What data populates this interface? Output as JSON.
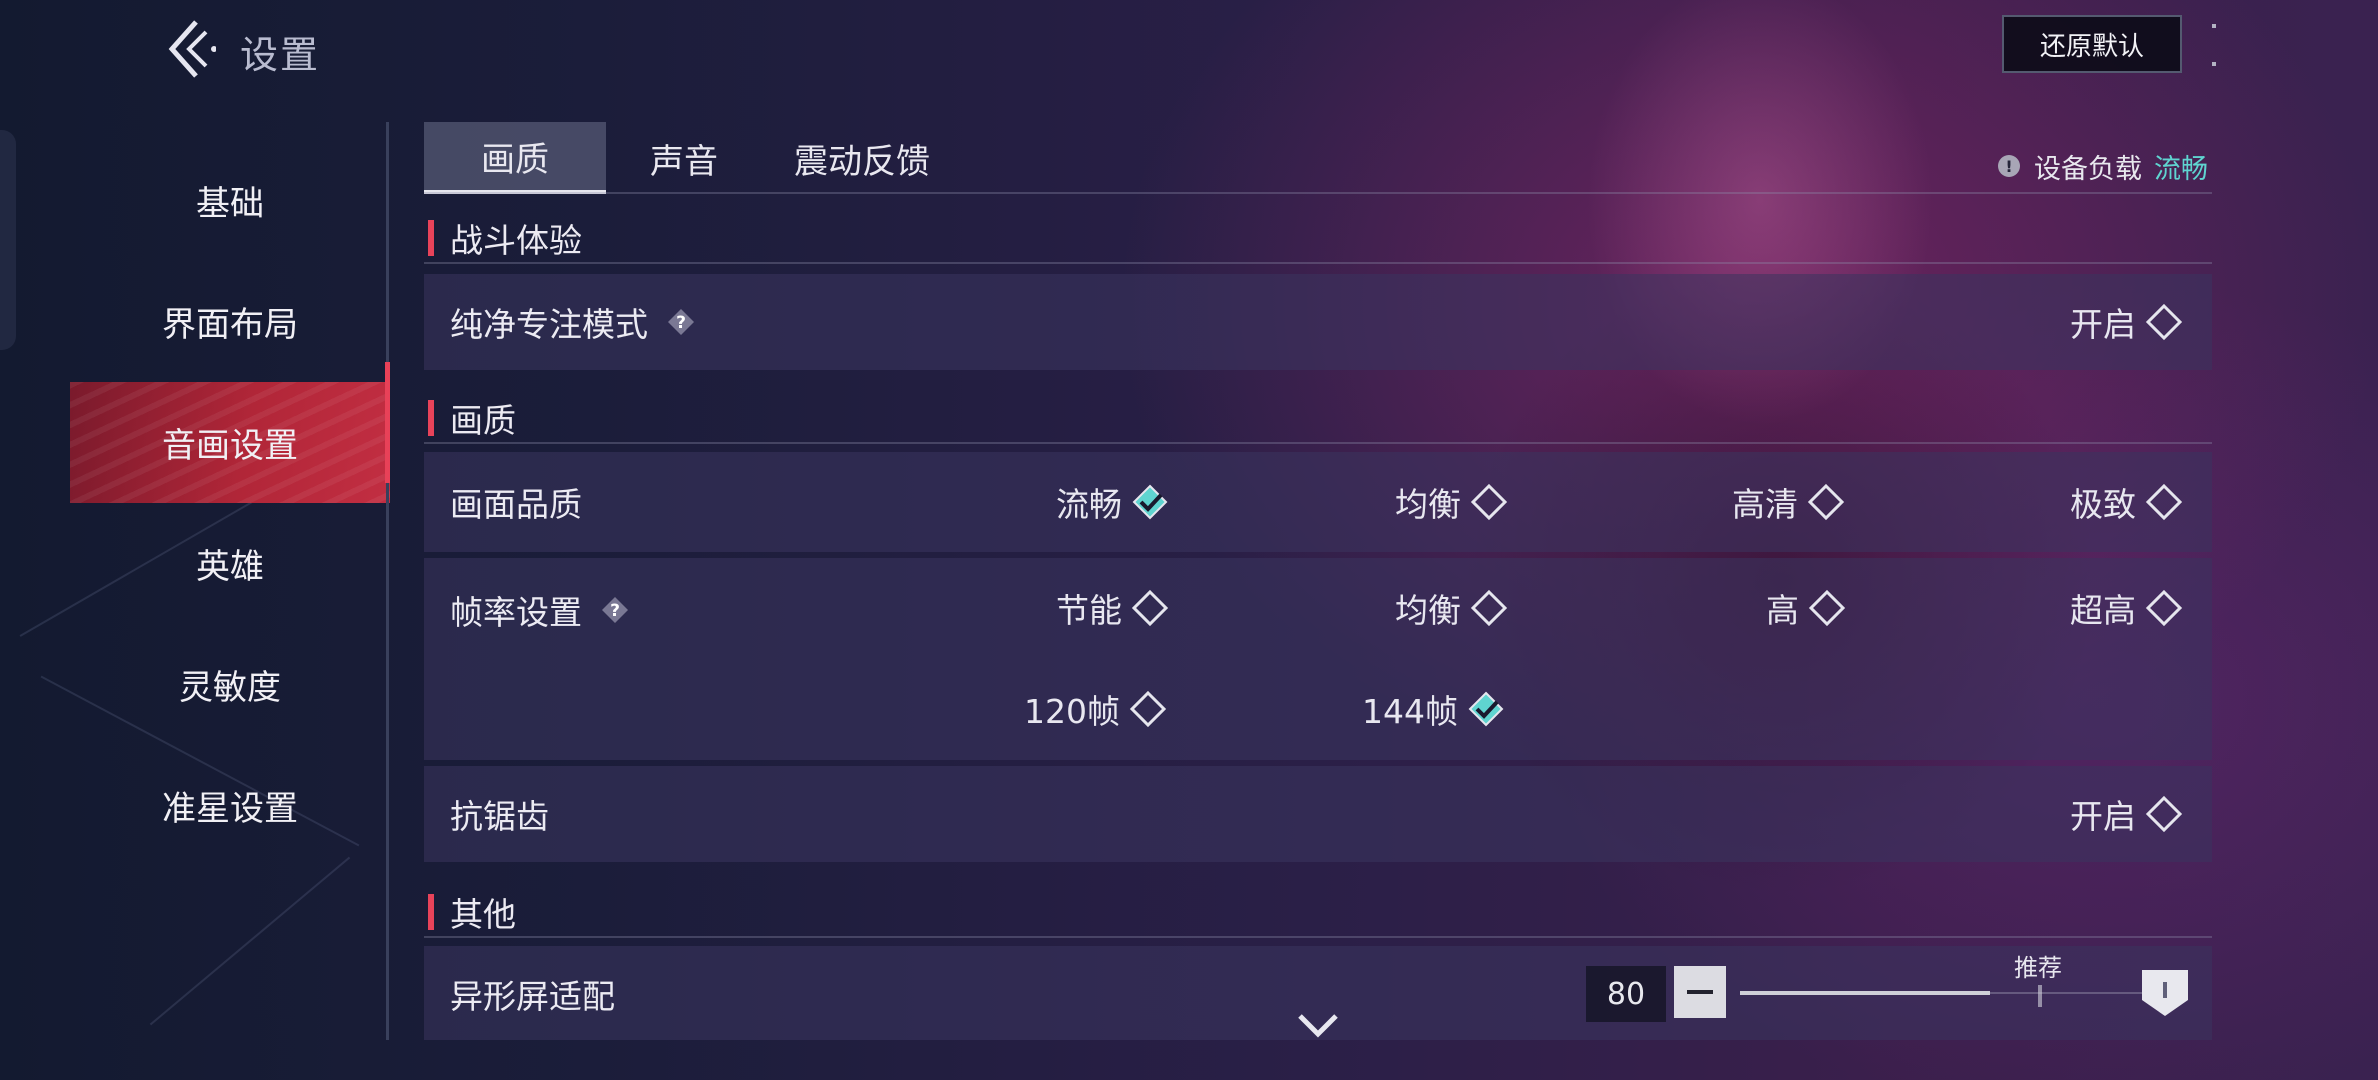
{
  "header": {
    "title": "设置",
    "back_icon": "chevron-left-icon",
    "restore_button": "还原默认"
  },
  "nav": {
    "items": [
      {
        "label": "基础",
        "active": false
      },
      {
        "label": "界面布局",
        "active": false
      },
      {
        "label": "音画设置",
        "active": true
      },
      {
        "label": "英雄",
        "active": false
      },
      {
        "label": "灵敏度",
        "active": false
      },
      {
        "label": "准星设置",
        "active": false
      }
    ]
  },
  "tabs": [
    {
      "label": "画质",
      "active": true
    },
    {
      "label": "声音",
      "active": false
    },
    {
      "label": "震动反馈",
      "active": false
    }
  ],
  "device_load": {
    "label": "设备负载",
    "value": "流畅",
    "value_color": "#5fd4d0",
    "icon": "warning-icon"
  },
  "sections": {
    "combat": {
      "title": "战斗体验",
      "pure_focus": {
        "label": "纯净专注模式",
        "option": "开启",
        "checked": false,
        "help_icon": "question-icon"
      }
    },
    "quality": {
      "title": "画质",
      "picture_quality": {
        "label": "画面品质",
        "options": [
          {
            "label": "流畅",
            "checked": true
          },
          {
            "label": "均衡",
            "checked": false
          },
          {
            "label": "高清",
            "checked": false
          },
          {
            "label": "极致",
            "checked": false
          }
        ]
      },
      "frame_rate": {
        "label": "帧率设置",
        "help_icon": "question-icon",
        "options": [
          {
            "label": "节能",
            "checked": false
          },
          {
            "label": "均衡",
            "checked": false
          },
          {
            "label": "高",
            "checked": false
          },
          {
            "label": "超高",
            "checked": false
          },
          {
            "label": "120帧",
            "checked": false
          },
          {
            "label": "144帧",
            "checked": true
          }
        ]
      },
      "anti_alias": {
        "label": "抗锯齿",
        "option": "开启",
        "checked": false
      }
    },
    "other": {
      "title": "其他",
      "notch_adapt": {
        "label": "异形屏适配",
        "value": "80",
        "recommend_label": "推荐",
        "minus_icon": "minus-icon"
      }
    }
  },
  "colors": {
    "accent_red": "#e8435a",
    "check_teal": "#5fd4d0"
  },
  "scroll_icon": "chevron-down-icon"
}
